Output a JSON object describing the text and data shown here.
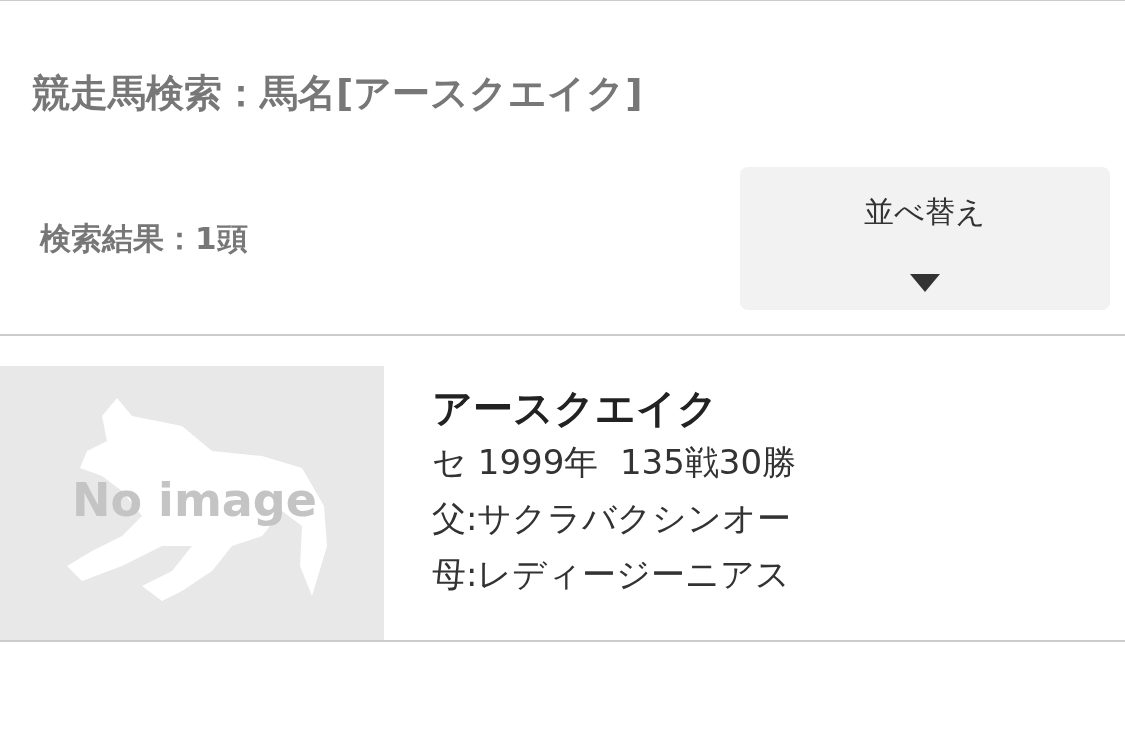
{
  "page_title": "競走馬検索：馬名[アースクエイク]",
  "result_count": "検索結果：1頭",
  "sort_button": {
    "label": "並べ替え"
  },
  "horses": [
    {
      "thumbnail": {
        "placeholder_text": "No image"
      },
      "name": "アースクエイク",
      "profile": "セ 1999年  135戦30勝",
      "sire": "父:サクラバクシンオー",
      "dam": "母:レディージーニアス"
    }
  ]
}
